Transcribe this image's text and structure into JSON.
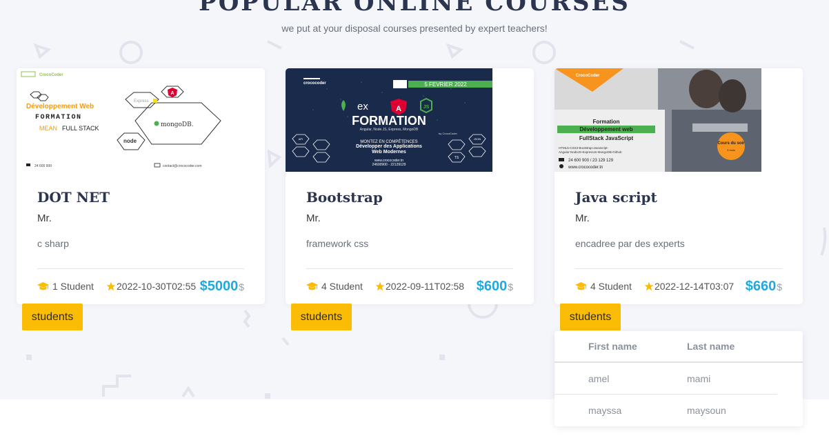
{
  "page": {
    "title": "POPULAR ONLINE COURSES",
    "subtitle": "we put at your disposal courses presented by expert teachers!"
  },
  "courses": [
    {
      "name": "DOT NET",
      "teacher": "Mr.",
      "description": "c sharp",
      "students_count": "1 Student",
      "date": "2022-10-30T02:55",
      "price": "$5000",
      "currency": "$",
      "students_button": "students",
      "image": {
        "brand": "CrocoCoder",
        "line1": "Développement Web",
        "line2": "FORMATION",
        "line3_a": "MEAN",
        "line3_b": "FULL STACK",
        "badge_express": "Express",
        "badge_mongo": "mongoDB.",
        "badge_node": "node",
        "phone": "24 600 900",
        "email": "contact@crococoder.com"
      }
    },
    {
      "name": "Bootstrap",
      "teacher": "Mr.",
      "description": "framework css",
      "students_count": "4 Student",
      "date": "2022-09-11T02:58",
      "price": "$600",
      "currency": "$",
      "students_button": "students",
      "image": {
        "brand": "crococoder",
        "date": "5 FEVRIER 2022",
        "ex": "ex",
        "js": "JS",
        "title": "FORMATION",
        "stack": "Angular, Node.JS, Express, MongoDB",
        "by": "by CrocoCoder",
        "line1": "MONTEZ EN COMPÉTENCES",
        "line2": "Développer des Applications",
        "line3": "Web Modernes",
        "site": "www.crococoder.tn",
        "phones": "24600900 - 22129129",
        "api": "API",
        "json": "JSON",
        "ts": "TS"
      }
    },
    {
      "name": "Java script",
      "teacher": "Mr.",
      "description": "encadree par des experts",
      "students_count": "4 Student",
      "date": "2022-12-14T03:07",
      "price": "$660",
      "currency": "$",
      "students_button": "students",
      "image": {
        "brand": "CrocoCoder",
        "line1": "Formation",
        "line2": "Développement web",
        "line3": "FullStack JavaScript",
        "line4": "HTML5-CSS3-Bootstrap-Javascript-",
        "line5": "Angular-NodeJS-ExpressJs-MongoDB-Github",
        "badge": "Cours du soir",
        "badge_sub": "3 mois",
        "phone": "24 600 900 / 23 129 129",
        "site": "www.crococoder.tn"
      }
    }
  ],
  "students_table": {
    "headers": [
      "First name",
      "Last name"
    ],
    "rows": [
      [
        "amel",
        "mami"
      ],
      [
        "mayssa",
        "maysoun"
      ]
    ]
  },
  "colors": {
    "accent": "#1ea9e1",
    "button": "#fbbc05",
    "icon_yellow": "#fbbc05",
    "heading": "#2c3550",
    "background": "#f5f6fa"
  },
  "icons": {
    "students": "graduation-cap-icon",
    "date": "star-icon"
  }
}
